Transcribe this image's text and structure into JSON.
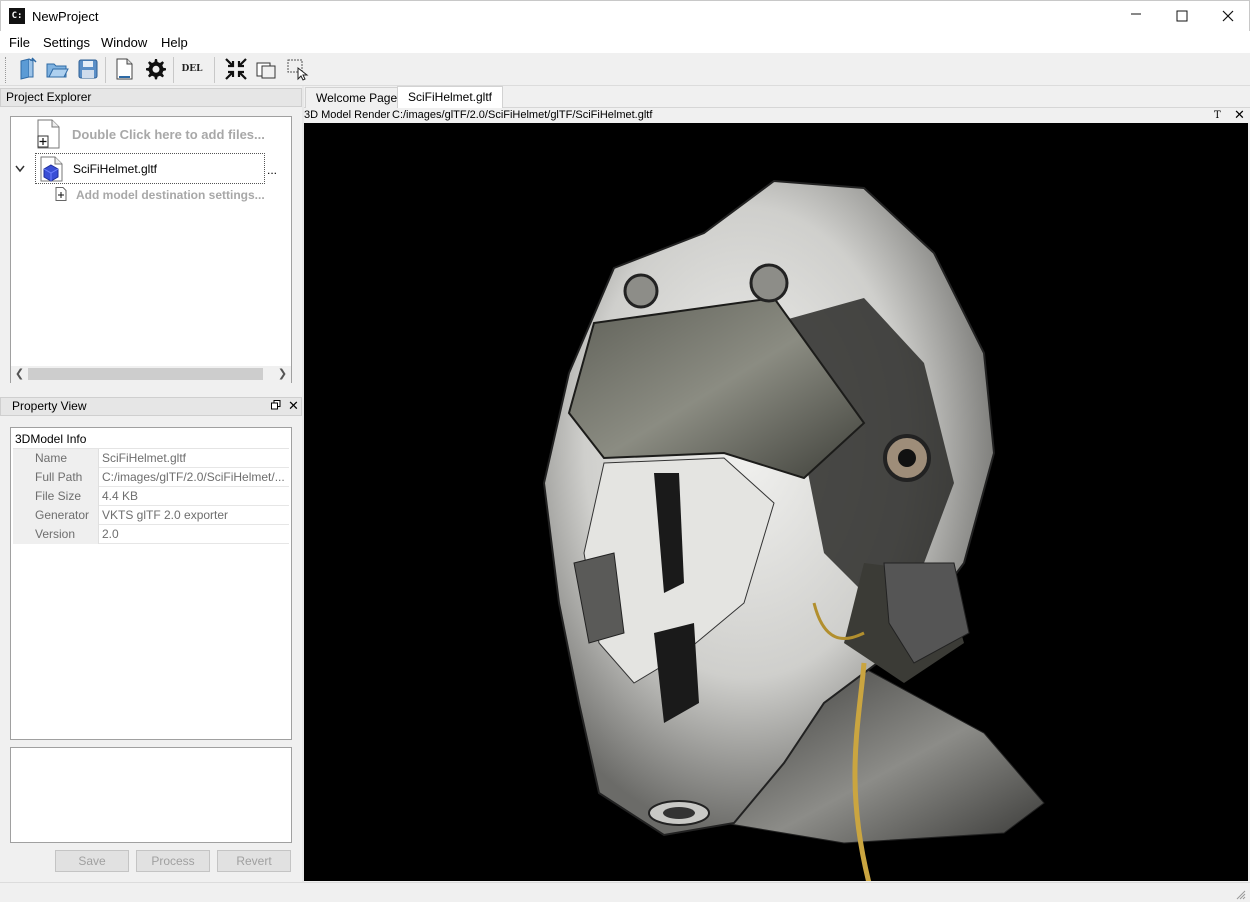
{
  "window": {
    "title": "NewProject",
    "icon_label": "C:",
    "controls": {
      "minimize": "—",
      "maximize": "☐",
      "close": "✕"
    }
  },
  "menu": [
    {
      "label": "File"
    },
    {
      "label": "Settings"
    },
    {
      "label": "Window"
    },
    {
      "label": "Help"
    }
  ],
  "toolbar": {
    "buttons": [
      "new-project-icon",
      "open-project-icon",
      "save-icon",
      "document-icon",
      "gear-icon",
      "delete-icon",
      "collapse-icon",
      "copy-window-icon",
      "select-region-icon"
    ],
    "del_label": "DEL"
  },
  "project_explorer": {
    "title": "Project Explorer",
    "add_files_text": "Double Click here to add files...",
    "model_name": "SciFiHelmet.gltf",
    "more_label": "...",
    "destination_text": "Add model destination settings..."
  },
  "property_view": {
    "title": "Property View",
    "group_label": "3DModel Info",
    "rows": [
      {
        "key": "Name",
        "value": "SciFiHelmet.gltf"
      },
      {
        "key": "Full Path",
        "value": "C:/images/glTF/2.0/SciFiHelmet/..."
      },
      {
        "key": "File Size",
        "value": "4.4 KB"
      },
      {
        "key": "Generator",
        "value": "VKTS glTF 2.0 exporter"
      },
      {
        "key": "Version",
        "value": "2.0"
      }
    ],
    "buttons": {
      "save": "Save",
      "process": "Process",
      "revert": "Revert"
    }
  },
  "tabs": [
    {
      "label": "Welcome Page",
      "active": false
    },
    {
      "label": "SciFiHelmet.gltf",
      "active": true
    }
  ],
  "render": {
    "title": "3D Model Render",
    "path": "C:/images/glTF/2.0/SciFiHelmet/glTF/SciFiHelmet.gltf",
    "t_label": "T",
    "close_label": "✕"
  },
  "colors": {
    "viewport_bg": "#000000",
    "placeholder_text": "#a8a8a8",
    "model_icon_blue": "#3a4fd6"
  }
}
